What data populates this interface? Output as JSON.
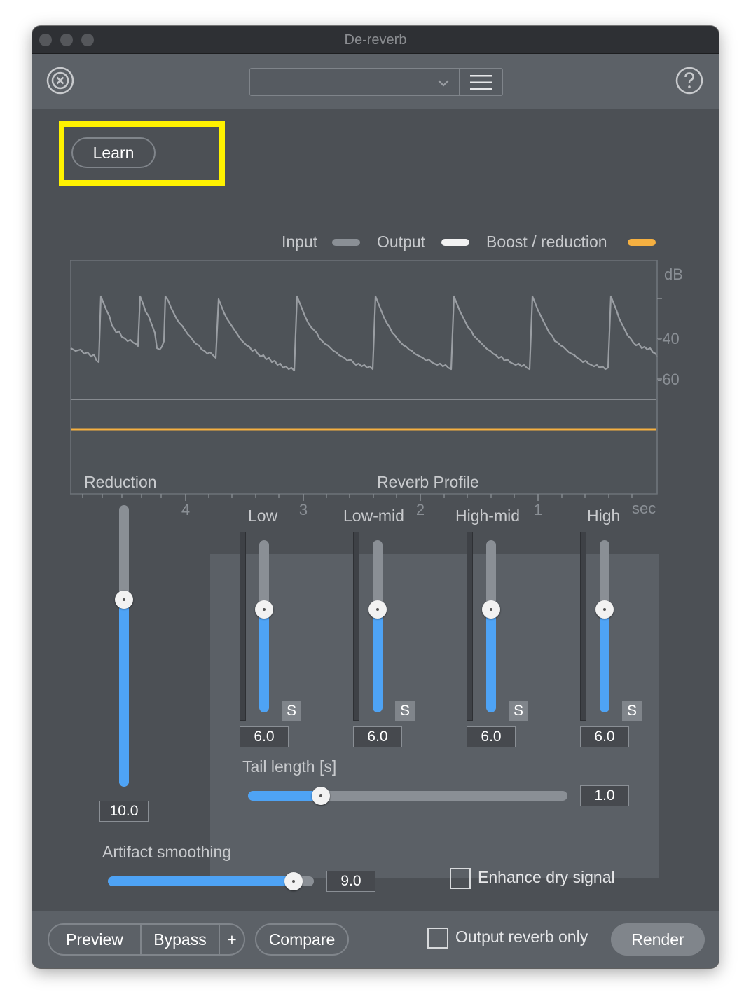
{
  "window": {
    "title": "De-reverb"
  },
  "toolbar": {
    "preset_value": ""
  },
  "learn": {
    "label": "Learn"
  },
  "legend": {
    "input": "Input",
    "output": "Output",
    "boost": "Boost / reduction",
    "colors": {
      "input": "#8a8f95",
      "output": "#f2f2f2",
      "boost": "#f5b041"
    }
  },
  "graph": {
    "y_unit": "dB",
    "y_ticks": [
      "-40",
      "-60"
    ],
    "x_ticks": [
      "4",
      "3",
      "2",
      "1"
    ],
    "x_unit": "sec"
  },
  "reduction": {
    "label": "Reduction",
    "value": "10.0",
    "level": 0.67
  },
  "reverb_profile": {
    "title": "Reverb Profile",
    "bands": [
      {
        "label": "Low",
        "value": "6.0",
        "solo": "S",
        "level": 0.61
      },
      {
        "label": "Low-mid",
        "value": "6.0",
        "solo": "S",
        "level": 0.61
      },
      {
        "label": "High-mid",
        "value": "6.0",
        "solo": "S",
        "level": 0.61
      },
      {
        "label": "High",
        "value": "6.0",
        "solo": "S",
        "level": 0.61
      }
    ],
    "tail_length": {
      "label": "Tail length [s]",
      "value": "1.0",
      "level": 0.23
    }
  },
  "artifact_smoothing": {
    "label": "Artifact smoothing",
    "value": "9.0",
    "level": 0.9
  },
  "enhance_dry": {
    "label": "Enhance dry signal",
    "checked": false
  },
  "bottom": {
    "preview": "Preview",
    "bypass": "Bypass",
    "plus": "+",
    "compare": "Compare",
    "output_reverb_only": "Output reverb only",
    "render": "Render"
  },
  "accent": "#4ea3f5",
  "highlight": "#fff200"
}
